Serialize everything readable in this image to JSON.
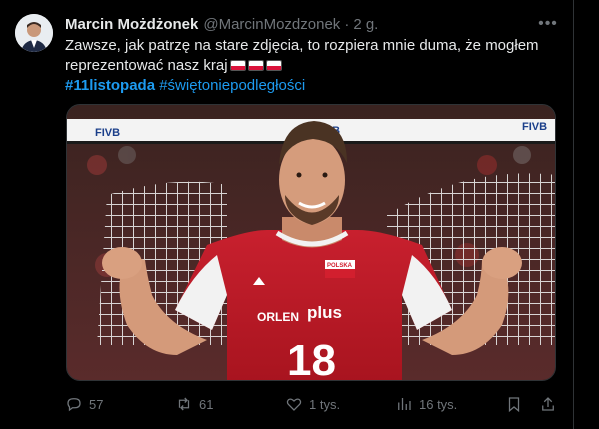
{
  "tweet": {
    "display_name": "Marcin Możdżonek",
    "handle": "@MarcinMozdzonek",
    "separator": "·",
    "time": "2 g.",
    "text_line1": "Zawsze, jak patrzę na stare zdjęcia, to rozpiera mnie duma, że mogłem",
    "text_line2": "reprezentować nasz kraj",
    "hashtag1": "#11listopada",
    "hashtag2": "#świętoniepodległości"
  },
  "media": {
    "banner_text_left": "FIVB",
    "banner_text_mid": "FIVB",
    "banner_text_right": "FIVB",
    "jersey_sponsor": "plus",
    "jersey_brand": "ORLEN",
    "jersey_number": "18",
    "flag_text": "POLSKA"
  },
  "actions": {
    "replies": "57",
    "retweets": "61",
    "likes": "1 tys.",
    "views": "16 tys."
  },
  "icons": [
    "avatar",
    "more-icon",
    "reply-icon",
    "retweet-icon",
    "like-icon",
    "views-icon",
    "bookmark-icon",
    "share-icon",
    "flag-pl-icon"
  ]
}
